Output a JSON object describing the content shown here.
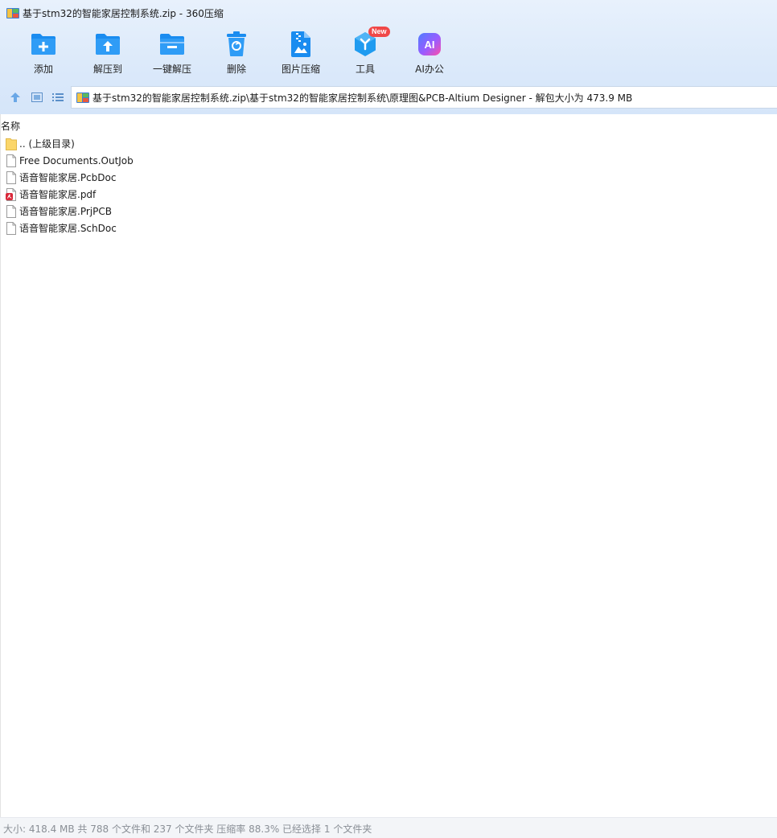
{
  "window": {
    "title": "基于stm32的智能家居控制系统.zip - 360压缩"
  },
  "toolbar": {
    "items": [
      {
        "id": "add",
        "label": "添加",
        "icon": "folder-plus-icon"
      },
      {
        "id": "extract-to",
        "label": "解压到",
        "icon": "folder-upload-icon"
      },
      {
        "id": "one-click-extract",
        "label": "一键解压",
        "icon": "folder-minus-icon"
      },
      {
        "id": "delete",
        "label": "删除",
        "icon": "trash-icon"
      },
      {
        "id": "image-compress",
        "label": "图片压缩",
        "icon": "image-zip-icon"
      },
      {
        "id": "tools",
        "label": "工具",
        "icon": "hexagon-tools-icon",
        "badge": "New"
      },
      {
        "id": "ai-office",
        "label": "AI办公",
        "icon": "ai-icon"
      }
    ]
  },
  "nav": {
    "address": "基于stm32的智能家居控制系统.zip\\基于stm32的智能家居控制系统\\原理图&PCB-Altium Designer - 解包大小为 473.9 MB"
  },
  "list": {
    "column_name": "名称",
    "files": [
      {
        "name": ".. (上级目录)",
        "icon": "folder-icon"
      },
      {
        "name": "Free Documents.OutJob",
        "icon": "file-icon"
      },
      {
        "name": "语音智能家居.PcbDoc",
        "icon": "file-icon"
      },
      {
        "name": "语音智能家居.pdf",
        "icon": "pdf-icon"
      },
      {
        "name": "语音智能家居.PrjPCB",
        "icon": "file-icon"
      },
      {
        "name": "语音智能家居.SchDoc",
        "icon": "file-icon"
      }
    ]
  },
  "status": {
    "text": "大小: 418.4 MB 共 788 个文件和 237 个文件夹 压缩率 88.3% 已经选择 1 个文件夹"
  },
  "colors": {
    "accent_blue": "#1a8cf0",
    "tools_blue": "#1f9bf0",
    "ai_gradient_start": "#4f7cff",
    "ai_gradient_end": "#ff4fa8",
    "badge_red": "#f04848",
    "chrome_bg": "#dbe9fa"
  }
}
